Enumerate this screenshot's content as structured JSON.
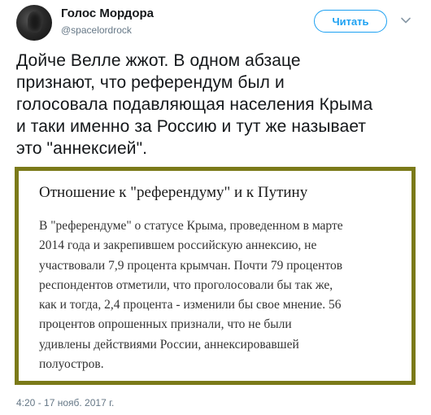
{
  "author": {
    "display_name": "Голос Мордора",
    "handle": "@spacelordrock"
  },
  "follow_button": {
    "label": "Читать"
  },
  "icons": {
    "avatar": "user-avatar",
    "menu": "chevron-down-icon"
  },
  "tweet": {
    "text_lines": [
      "Дойче Велле жжот. В одном абзаце",
      "признают, что референдум был и",
      "голосовала подавляющая населения Крыма",
      "и таки именно за Россию и тут же называет",
      "это \"аннексией\"."
    ]
  },
  "attachment": {
    "heading": "Отношение к \"референдуму\" и к Путину",
    "body_lines": [
      "В \"референдуме\" о статусе Крыма, проведенном в марте",
      "2014 года и закрепившем российскую аннексию, не",
      "участвовали 7,9 процента крымчан. Почти 79 процентов",
      "респондентов отметили, что проголосовали бы так же,",
      "как и тогда, 2,4 процента - изменили бы свое мнение. 56",
      "процентов опрошенных признали, что не были",
      "удивлены действиями России, аннексировавшей",
      "полуостров."
    ],
    "border_color": "#7b7a19"
  },
  "timestamp": "4:20 - 17 нояб. 2017 г.",
  "colors": {
    "accent": "#1da1f2",
    "text": "#14171a",
    "secondary": "#657786"
  }
}
